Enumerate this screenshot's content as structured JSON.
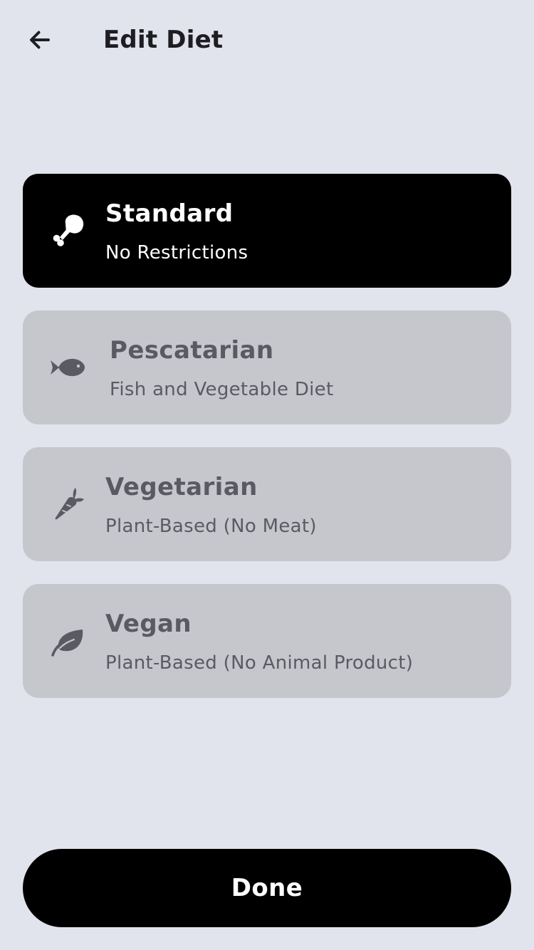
{
  "header": {
    "title": "Edit Diet",
    "back_icon": "arrow-left-icon"
  },
  "options": [
    {
      "title": "Standard",
      "subtitle": "No Restrictions",
      "icon": "drumstick-icon",
      "selected": true
    },
    {
      "title": "Pescatarian",
      "subtitle": "Fish and Vegetable Diet",
      "icon": "fish-icon",
      "selected": false
    },
    {
      "title": "Vegetarian",
      "subtitle": "Plant-Based (No Meat)",
      "icon": "carrot-icon",
      "selected": false
    },
    {
      "title": "Vegan",
      "subtitle": "Plant-Based (No Animal Product)",
      "icon": "leaf-icon",
      "selected": false
    }
  ],
  "footer": {
    "done_label": "Done"
  },
  "colors": {
    "background": "#e1e4ec",
    "selected_card": "#000000",
    "unselected_card": "#c6c7cc",
    "unselected_text": "#5a5b62",
    "selected_text": "#ffffff"
  }
}
